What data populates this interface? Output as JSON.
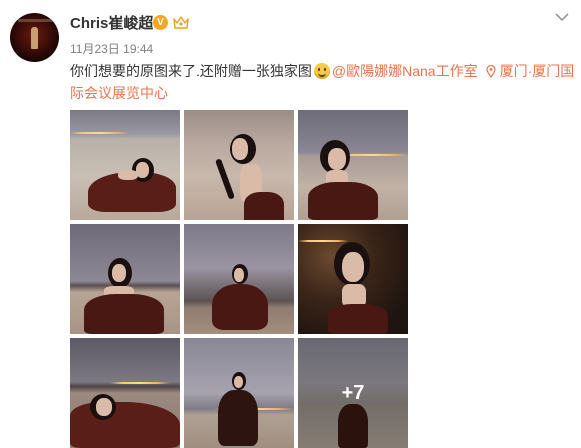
{
  "post": {
    "username": "Chris崔峻超",
    "verified_badge": "V",
    "timestamp": "11月23日 19:44",
    "text_main": "你们想要的原图来了.还附赠一张独家图",
    "mention": "@歐陽娜娜Nana工作室",
    "location": "厦门·厦门国际会议展览中心",
    "more_count": "+7"
  },
  "icons": {
    "badge": "verified-badge-icon",
    "crown": "crown-icon",
    "menu": "chevron-down-icon",
    "emoji": "smile-emoji-icon",
    "location": "location-pin-icon"
  },
  "colors": {
    "link": "#eb7350",
    "username": "#333333",
    "timestamp": "#808080",
    "badge": "#f5a623"
  }
}
